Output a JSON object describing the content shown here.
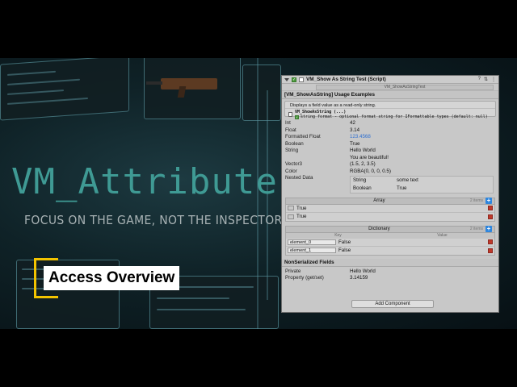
{
  "hero": {
    "title": "VM_Attributes",
    "subtitle": "FOCUS ON THE GAME, NOT THE INSPECTOR",
    "badge": "Access Overview"
  },
  "colors": {
    "accent": "#3f9a94",
    "badge_bracket": "#f2c300",
    "plus_button": "#2e86de",
    "delete_button": "#c0392b",
    "float_value": "#2f6fcf"
  },
  "inspector": {
    "header_title": "VM_Show As String Test (Script)",
    "script_label": "Script",
    "script_value": "VM_ShowAsStringTest",
    "section_title": "[VM_ShowAsString] Usage Examples",
    "hint_line1": "Displays a field value as a read-only string.",
    "hint_line2": "VM_ShowAsString (...)",
    "hint_line3": "string format - optional format string for IFormattable types (default: null)",
    "fields": [
      {
        "label": "Int",
        "value": "42"
      },
      {
        "label": "Float",
        "value": "3.14"
      },
      {
        "label": "Formatted Float",
        "value": "123.4568"
      },
      {
        "label": "Boolean",
        "value": "True"
      },
      {
        "label": "String",
        "value": "Hello World\nYou are beautiful!"
      },
      {
        "label": "Vector3",
        "value": "(1.5, 2, 3.5)"
      },
      {
        "label": "Color",
        "value": "RGBA(0, 0, 0, 0.5)"
      }
    ],
    "nested_label": "Nested Data",
    "nested": [
      {
        "k": "String",
        "v": "some text"
      },
      {
        "k": "Boolean",
        "v": "True"
      }
    ],
    "array": {
      "title": "Array",
      "count": "2 items",
      "items": [
        "True",
        "True"
      ]
    },
    "dictionary": {
      "title": "Dictionary",
      "count": "2 items",
      "col_key": "Key",
      "col_value": "Value",
      "items": [
        {
          "k": "element_0",
          "v": "False"
        },
        {
          "k": "element_1",
          "v": "False"
        }
      ]
    },
    "nonserialized_title": "NonSerialized Fields",
    "nonserialized": [
      {
        "label": "Private",
        "value": "Hello World"
      },
      {
        "label": "Property (get/set)",
        "value": "3.14159"
      }
    ],
    "add_component": "Add Component"
  }
}
